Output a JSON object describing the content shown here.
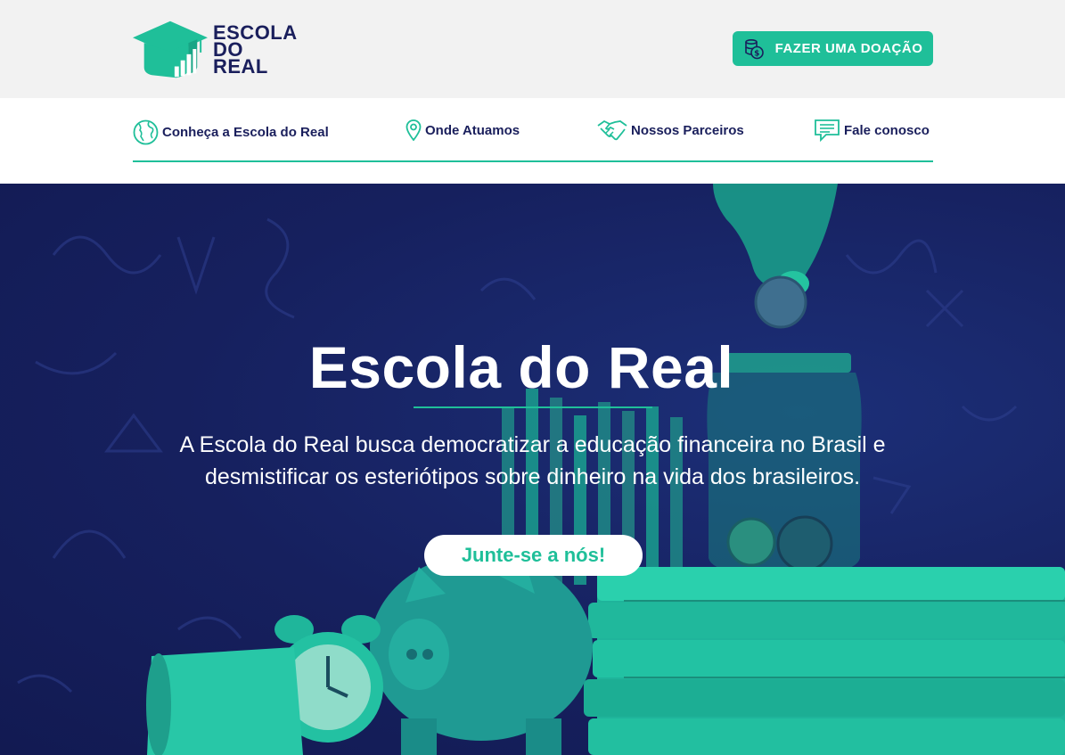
{
  "brand": {
    "line1": "ESCOLA",
    "line2": "DO REAL",
    "colors": {
      "navy": "#1a1f5c",
      "teal": "#1fbf99"
    }
  },
  "header": {
    "donate_label": "FAZER UMA DOAÇÃO",
    "donate_icon": "coin-stack-icon"
  },
  "nav": {
    "items": [
      {
        "label": "Conheça a Escola do Real",
        "icon": "globe-icon"
      },
      {
        "label": "Onde Atuamos",
        "icon": "map-pin-icon"
      },
      {
        "label": "Nossos Parceiros",
        "icon": "handshake-icon"
      },
      {
        "label": "Fale conosco",
        "icon": "chat-icon"
      }
    ]
  },
  "hero": {
    "title": "Escola do Real",
    "description": "A Escola do Real busca democratizar a educação financeira no Brasil e desmistificar os esteriótipos sobre dinheiro na vida dos brasileiros.",
    "cta_label": "Junte-se a nós!"
  }
}
